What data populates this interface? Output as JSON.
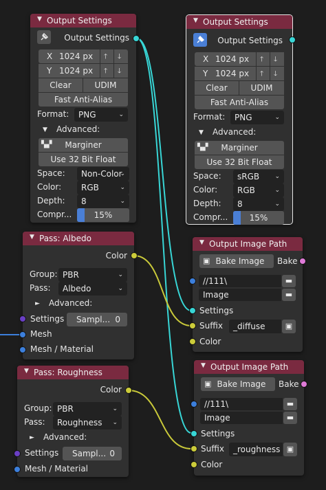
{
  "output_settings": {
    "title": "Output Settings",
    "output_label": "Output Settings",
    "x_label": "X",
    "x_value": "1024 px",
    "y_label": "Y",
    "y_value": "1024 px",
    "clear_label": "Clear",
    "udim_label": "UDIM",
    "fast_aa_label": "Fast Anti-Alias",
    "format_label": "Format:",
    "format_value": "PNG",
    "advanced_label": "Advanced:",
    "marginer_label": "Marginer",
    "float_label": "Use 32 Bit Float",
    "space_label": "Space:",
    "color_label": "Color:",
    "color_value": "RGB",
    "depth_label": "Depth:",
    "depth_value": "8",
    "compr_label": "Compr...",
    "compr_value": "15%",
    "compr_fraction": 0.15
  },
  "node_left_space": "Non-Color",
  "node_right_space": "sRGB",
  "pass_albedo": {
    "title": "Pass: Albedo",
    "color_label": "Color",
    "group_label": "Group:",
    "group_value": "PBR",
    "pass_label": "Pass:",
    "pass_value": "Albedo",
    "advanced_label": "Advanced:",
    "settings_label": "Settings",
    "sample_label": "Sampl...",
    "sample_value": "0",
    "mesh_label": "Mesh",
    "mesh_material_label": "Mesh / Material"
  },
  "pass_roughness": {
    "title": "Pass: Roughness",
    "color_label": "Color",
    "group_label": "Group:",
    "group_value": "PBR",
    "pass_label": "Pass:",
    "pass_value": "Roughness",
    "advanced_label": "Advanced:",
    "settings_label": "Settings",
    "sample_label": "Sampl...",
    "sample_value": "0",
    "mesh_material_label": "Mesh / Material"
  },
  "path_albedo": {
    "title": "Output Image Path",
    "bake_image_label": "Bake Image",
    "bake_label": "Bake",
    "path_value": "//111\\",
    "name_value": "Image",
    "settings_label": "Settings",
    "suffix_label": "Suffix",
    "suffix_value": "_diffuse",
    "color_label": "Color"
  },
  "path_roughness": {
    "title": "Output Image Path",
    "bake_image_label": "Bake Image",
    "bake_label": "Bake",
    "path_value": "//111\\",
    "name_value": "Image",
    "settings_label": "Settings",
    "suffix_label": "Suffix",
    "suffix_value": "_roughness",
    "color_label": "Color"
  },
  "colors": {
    "header": "#7a2a40",
    "node_body": "#303030",
    "socket_cyan": "#38d6d6",
    "socket_yellow": "#cccc3a",
    "socket_pink": "#e07bd8",
    "socket_blue": "#3c7fdc",
    "socket_purple": "#6a3fc4",
    "accent_blue": "#4a7fd6"
  },
  "icons": [
    "chevron-down-icon",
    "pin-icon",
    "arrow-up-icon",
    "arrow-down-icon",
    "marginer-icon",
    "triangle-right-icon",
    "image-icon",
    "folder-icon",
    "file-browse-icon"
  ]
}
